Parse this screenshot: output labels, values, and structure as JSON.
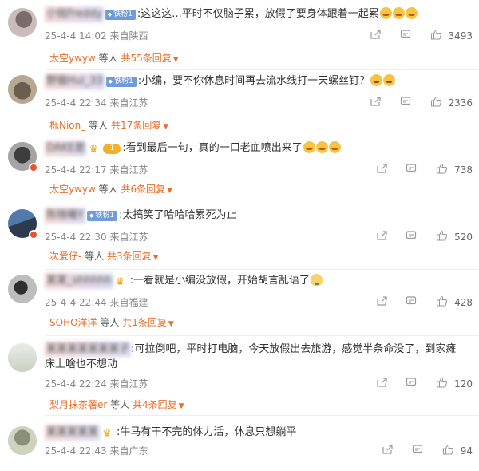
{
  "comments": [
    {
      "username": "小铭Freddy",
      "fan_label": "铁粉1",
      "text": ":这这这...平时不仅脑子累，放假了要身体跟着一起累",
      "emojis": 3,
      "date": "25-4-4 14:02",
      "location": "来自陕西",
      "likes": "3493",
      "reply_name": "太空ywyw",
      "reply_mid": "等人",
      "reply_count": "共55条回复"
    },
    {
      "username": "野猫Hui_33",
      "fan_label": "铁粉1",
      "text": ":小编，要不你休息时间再去流水线打一天螺丝钉？",
      "emojis": 2,
      "date": "25-4-4 22:34",
      "location": "来自江苏",
      "likes": "2336",
      "reply_name": "栎Nion_",
      "reply_mid": "等人",
      "reply_count": "共17条回复"
    },
    {
      "username": "DAKE是",
      "badge_num": "1",
      "text": ":看到最后一句，真的一口老血喷出来了",
      "emojis": 3,
      "date": "25-4-4 22:17",
      "location": "来自江苏",
      "likes": "738",
      "reply_name": "太空ywyw",
      "reply_mid": "等人",
      "reply_count": "共6条回复"
    },
    {
      "username": "陈晓曦Y",
      "fan_label": "铁粉1",
      "text": ":太搞笑了哈哈哈累死为止",
      "emojis": 0,
      "date": "25-4-4 22:30",
      "location": "来自江苏",
      "likes": "520",
      "reply_name": "次爱仔-",
      "reply_mid": "等人",
      "reply_count": "共3条回复"
    },
    {
      "username": "某某_ohhhhh",
      "text": ":一看就是小编没放假，开始胡言乱语了",
      "emojis": 1,
      "date": "25-4-4 22:44",
      "location": "来自福建",
      "likes": "428",
      "reply_name": "SOHO洋洋",
      "reply_mid": "等人",
      "reply_count": "共1条回复"
    },
    {
      "username": "某某某某某某某子",
      "text": ":可拉倒吧，平时打电脑，今天放假出去旅游，感觉半条命没了，到家瘫床上啥也不想动",
      "emojis": 0,
      "date": "25-4-4 22:24",
      "location": "来自江苏",
      "likes": "120",
      "reply_name": "梨月抹茶薯er",
      "reply_mid": "等人",
      "reply_count": "共4条回复"
    },
    {
      "username": "某某某某某",
      "text": ":牛马有干不完的体力活，休息只想躺平",
      "emojis": 0,
      "date": "25-4-4 22:43",
      "location": "来自广东",
      "likes": "94"
    }
  ],
  "icons": {
    "share": "share-icon",
    "comment": "comment-icon",
    "like": "thumbs-up-icon"
  },
  "colors": {
    "reply_accent": "#e86e2b",
    "meta_gray": "#888888"
  }
}
